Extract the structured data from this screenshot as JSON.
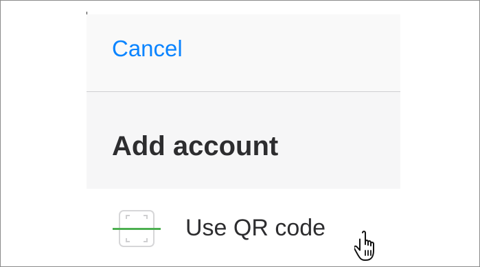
{
  "header": {
    "cancel_label": "Cancel"
  },
  "main": {
    "title": "Add account",
    "qr_option": {
      "label": "Use QR code",
      "icon": "qr-scan-icon"
    }
  },
  "cursor": {
    "icon": "hand-pointer-icon"
  },
  "colors": {
    "accent": "#0a84ff",
    "scan_line": "#4caf50",
    "text": "#2d2d2f",
    "sheet_bg": "#f6f6f7"
  }
}
